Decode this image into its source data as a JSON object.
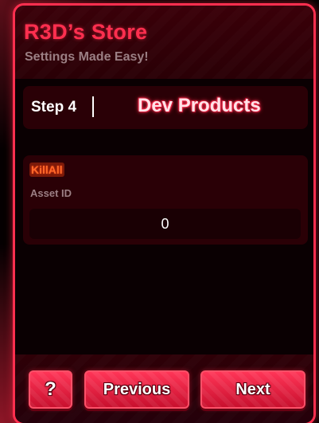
{
  "store": {
    "title": "R3D’s Store",
    "subtitle": "Settings Made Easy!"
  },
  "step": {
    "label": "Step 4",
    "title": "Dev Products"
  },
  "product": {
    "name": "KillAll",
    "asset_label": "Asset ID",
    "asset_value": "0"
  },
  "footer": {
    "help_label": "?",
    "previous_label": "Previous",
    "next_label": "Next"
  },
  "colors": {
    "accent": "#ff2f4f",
    "panel_bg": "#2a0006",
    "muted_text": "#9b7f84"
  }
}
